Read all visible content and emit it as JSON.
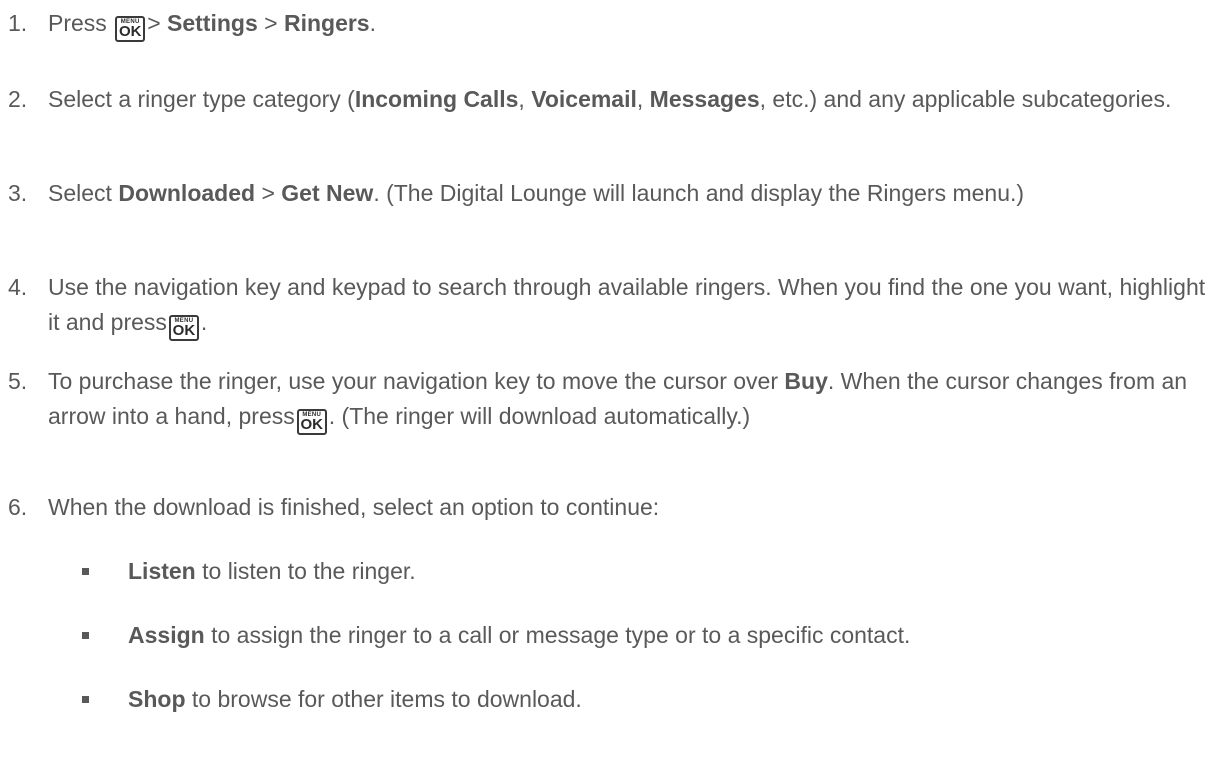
{
  "key_icon": {
    "top": "MENU",
    "bottom": "OK"
  },
  "steps": [
    {
      "num": "1.",
      "parts": [
        "Press",
        "> ",
        "Settings",
        " > ",
        "Ringers",
        "."
      ]
    },
    {
      "num": "2.",
      "parts": [
        "Select a ringer type category (",
        "Incoming Calls",
        ", ",
        "Voicemail",
        ", ",
        "Messages",
        ", etc.) and any applicable subcategories."
      ]
    },
    {
      "num": "3.",
      "parts": [
        "Select ",
        "Downloaded",
        " > ",
        "Get New",
        ". (The Digital Lounge will launch and display the Ringers menu.)"
      ]
    },
    {
      "num": "4.",
      "parts": [
        "Use the navigation key and keypad to search through available ringers. When you find the one you want, highlight it and press",
        "."
      ]
    },
    {
      "num": "5.",
      "parts": [
        "To purchase the ringer, use your navigation key to move the cursor over ",
        "Buy",
        ". When the cursor changes from an arrow into a hand, press",
        ". (The ringer will download automatically.)"
      ]
    },
    {
      "num": "6.",
      "parts": [
        "When the download is finished, select an option to continue:"
      ]
    }
  ],
  "options": [
    {
      "term": "Listen",
      "text": " to listen to the ringer."
    },
    {
      "term": "Assign",
      "text": " to assign the ringer to a call or message type or to a specific contact."
    },
    {
      "term": "Shop",
      "text": " to browse for other items to download."
    }
  ]
}
